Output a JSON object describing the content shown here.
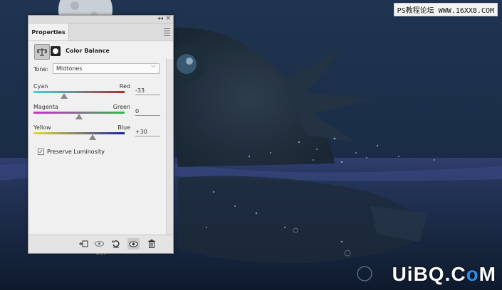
{
  "watermarks": {
    "top": "PS教程论坛 WWW.16XX8.COM",
    "bottom_parts": [
      "UiBQ.C",
      "o",
      "M"
    ]
  },
  "panel": {
    "tab_label": "Properties",
    "adjustment_title": "Color Balance",
    "tone": {
      "label": "Tone:",
      "selected": "Midtones"
    },
    "sliders": [
      {
        "left": "Cyan",
        "right": "Red",
        "value": "-33",
        "level": -33,
        "min": -100,
        "max": 100
      },
      {
        "left": "Magenta",
        "right": "Green",
        "value": "0",
        "level": 0,
        "min": -100,
        "max": 100
      },
      {
        "left": "Yellow",
        "right": "Blue",
        "value": "+30",
        "level": 30,
        "min": -100,
        "max": 100
      }
    ],
    "preserve_luminosity": {
      "label": "Preserve Luminosity",
      "checked": true
    }
  },
  "colors": {
    "cyan": "#39d6e3",
    "red": "#b52a2a",
    "magenta": "#cf2cd0",
    "green": "#31b84a",
    "yellow": "#e3de22",
    "blue": "#1b1fa6",
    "logo_accent": "#2b8fe8"
  },
  "icons": {
    "bottom_bar": [
      "clip-to-layer-icon",
      "view-previous-state-icon",
      "reset-icon",
      "visibility-icon",
      "delete-icon"
    ]
  }
}
